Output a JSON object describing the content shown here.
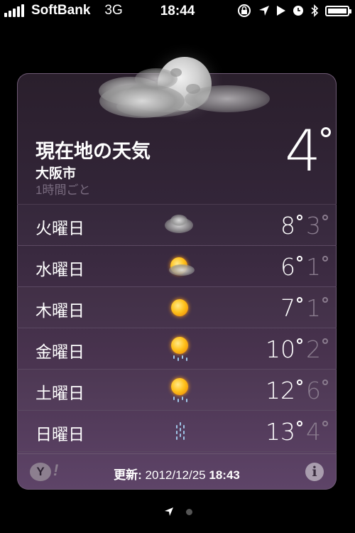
{
  "status_bar": {
    "carrier": "SoftBank",
    "network": "3G",
    "time": "18:44"
  },
  "weather": {
    "location_title": "現在地の天気",
    "city": "大阪市",
    "subtitle": "1時間ごと",
    "current_temp": "4",
    "forecast": [
      {
        "day": "火曜日",
        "icon": "cloudy-icon",
        "high": "8",
        "low": "3"
      },
      {
        "day": "水曜日",
        "icon": "partly-cloudy-icon",
        "high": "6",
        "low": "1"
      },
      {
        "day": "木曜日",
        "icon": "sun-icon",
        "high": "7",
        "low": "1"
      },
      {
        "day": "金曜日",
        "icon": "sun-rain-icon",
        "high": "10",
        "low": "2"
      },
      {
        "day": "土曜日",
        "icon": "sun-rain-icon",
        "high": "12",
        "low": "6"
      },
      {
        "day": "日曜日",
        "icon": "rain-icon",
        "high": "13",
        "low": "4"
      }
    ],
    "footer": {
      "updated_label": "更新:",
      "updated_date": "2012/12/25",
      "updated_time": "18:43",
      "yahoo_logo": "Y!"
    }
  },
  "pager": {
    "current": 1,
    "total": 2
  }
}
